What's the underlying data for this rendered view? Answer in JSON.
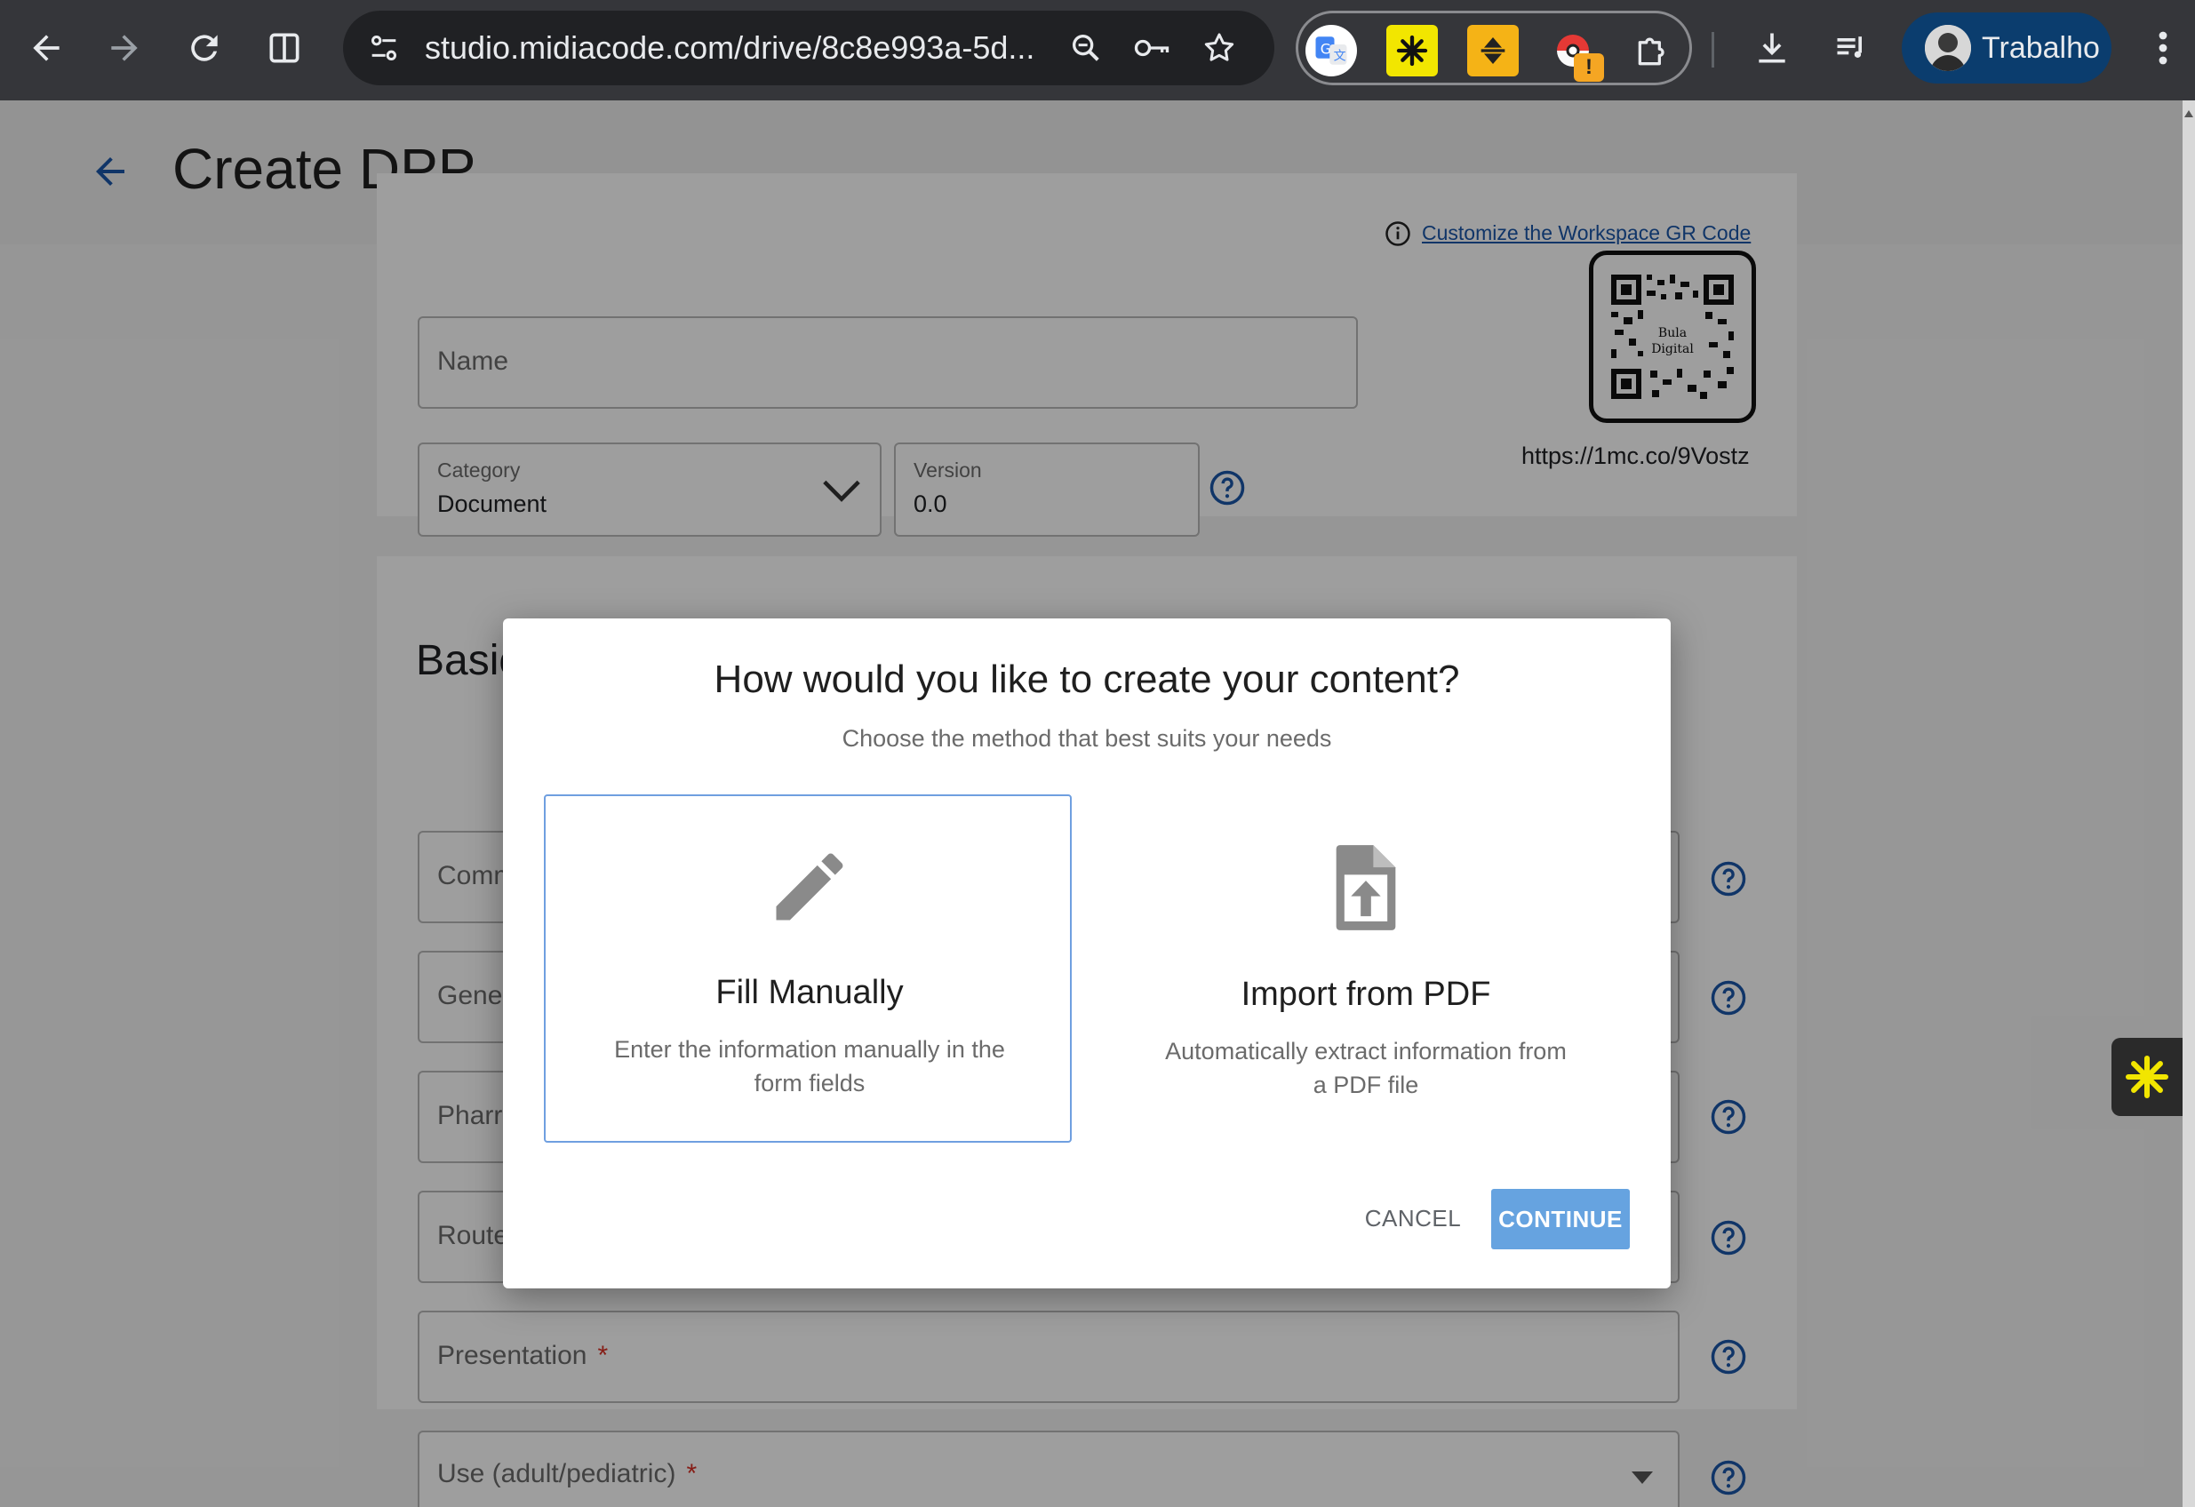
{
  "browser": {
    "url": "studio.midiacode.com/drive/8c8e993a-5d...",
    "profile_name": "Trabalho",
    "icons": {
      "back": "back-arrow-icon",
      "forward": "forward-arrow-icon",
      "reload": "reload-icon",
      "split": "split-view-icon",
      "site_settings": "tune-icon",
      "zoom": "zoom-icon",
      "password": "key-icon",
      "bookmark": "star-icon",
      "downloads": "download-icon",
      "media": "media-queue-icon",
      "menu": "kebab-menu-icon"
    },
    "extensions": [
      "google-translate-icon",
      "asterisk-extension-icon",
      "sort-extension-icon",
      "pokeball-extension-icon",
      "puzzle-extension-icon"
    ],
    "warning_badge": "!"
  },
  "page": {
    "title": "Create DPP",
    "name_placeholder": "Name",
    "category": {
      "label": "Category",
      "value": "Document"
    },
    "version": {
      "label": "Version",
      "value": "0.0"
    },
    "qr": {
      "customize_link": "Customize the Workspace GR Code",
      "center_text_1": "Bula",
      "center_text_2": "Digital",
      "short_url": "https://1mc.co/9Vostz"
    },
    "section_title": "Basic",
    "fields": [
      {
        "label": "Comm",
        "required": false
      },
      {
        "label": "Gener",
        "required": false
      },
      {
        "label": "Pharr",
        "required": false
      },
      {
        "label": "Route",
        "required": false
      },
      {
        "label": "Presentation",
        "required": true
      },
      {
        "label": "Use (adult/pediatric)",
        "required": true
      }
    ],
    "required_mark": "*"
  },
  "dialog": {
    "title": "How would you like to create your content?",
    "subtitle": "Choose the method that best suits your needs",
    "options": [
      {
        "title": "Fill Manually",
        "description": "Enter the information manually in the form fields",
        "selected": true,
        "icon": "pencil-icon"
      },
      {
        "title": "Import from PDF",
        "description": "Automatically extract information from a PDF file",
        "selected": false,
        "icon": "file-upload-icon"
      }
    ],
    "cancel_label": "CANCEL",
    "continue_label": "CONTINUE"
  },
  "colors": {
    "accent": "#1a56a8",
    "continue_button": "#66a3e0",
    "selected_border": "#6f9fe0",
    "profile_chip": "#0b3d6e",
    "required": "#d93025"
  }
}
